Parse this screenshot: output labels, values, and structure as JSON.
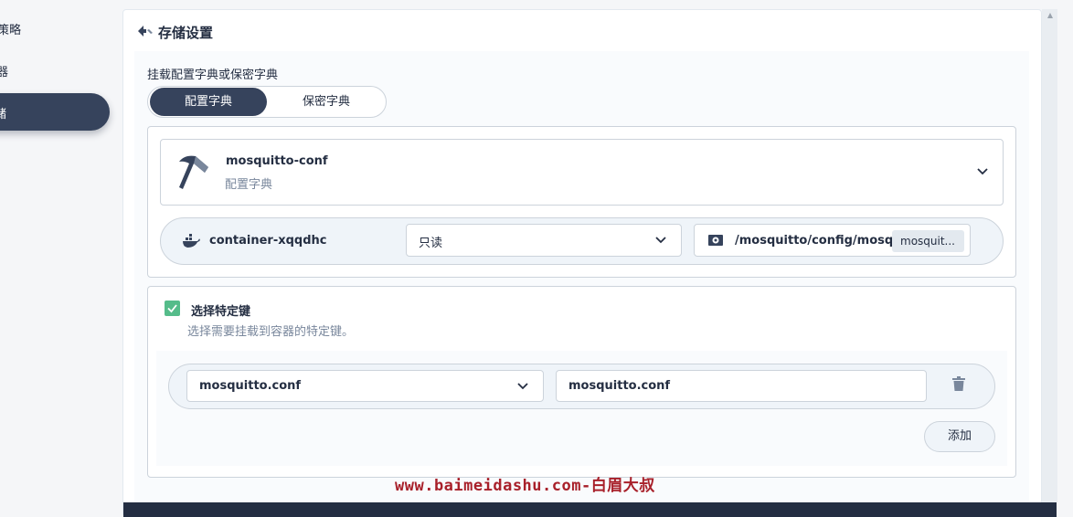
{
  "sidebar": {
    "item_partial_1": "策略",
    "item_partial_2": "器",
    "item_active_partial": "储"
  },
  "header": {
    "title": "存储设置",
    "back_icon": "back-arrow-icon"
  },
  "mount": {
    "label": "挂载配置字典或保密字典",
    "toggle": {
      "option_configmap": "配置字典",
      "option_secret": "保密字典",
      "selected": "配置字典"
    }
  },
  "configmap": {
    "name": "mosquitto-conf",
    "type": "配置字典",
    "icon": "hammer-icon"
  },
  "container": {
    "name": "container-xqqdhc",
    "icon": "docker-icon",
    "access_mode": "只读",
    "mount_path": "/mosquitto/config/mosquitto.conf",
    "mount_path_tag": "mosquit..."
  },
  "specific_keys": {
    "checked": true,
    "label": "选择特定键",
    "description": "选择需要挂载到容器的特定键。",
    "rows": [
      {
        "key": "mosquitto.conf",
        "path": "mosquitto.conf"
      }
    ],
    "add_label": "添加"
  },
  "watermark": "www.baimeidashu.com-白眉大叔",
  "colors": {
    "primary_dark": "#36435c",
    "check_green": "#55bc8a",
    "border": "#ccd3db",
    "watermark_red": "#a8202a"
  }
}
